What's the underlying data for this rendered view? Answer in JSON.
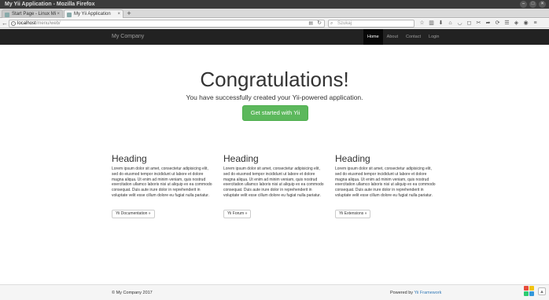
{
  "window": {
    "title": "My Yii Application - Mozilla Firefox"
  },
  "tabs": [
    {
      "label": "Start Page - Linux Mi",
      "active": false
    },
    {
      "label": "My Yii Application",
      "active": true
    }
  ],
  "address_bar": {
    "host": "localhost",
    "path": "/menu/web/",
    "search_placeholder": "Szukaj"
  },
  "site": {
    "brand": "My Company",
    "menu": [
      {
        "label": "Home",
        "active": true
      },
      {
        "label": "About",
        "active": false
      },
      {
        "label": "Contact",
        "active": false
      },
      {
        "label": "Login",
        "active": false
      }
    ]
  },
  "jumbotron": {
    "title": "Congratulations!",
    "lead": "You have successfully created your Yii-powered application.",
    "button": "Get started with Yii"
  },
  "columns": [
    {
      "heading": "Heading",
      "text": "Lorem ipsum dolor sit amet, consectetur adipisicing elit, sed do eiusmod tempor incididunt ut labore et dolore magna aliqua. Ut enim ad minim veniam, quis nostrud exercitation ullamco laboris nisi ut aliquip ex ea commodo consequat. Duis aute irure dolor in reprehenderit in voluptate velit esse cillum dolore eu fugiat nulla pariatur.",
      "button": "Yii Documentation »"
    },
    {
      "heading": "Heading",
      "text": "Lorem ipsum dolor sit amet, consectetur adipisicing elit, sed do eiusmod tempor incididunt ut labore et dolore magna aliqua. Ut enim ad minim veniam, quis nostrud exercitation ullamco laboris nisi ut aliquip ex ea commodo consequat. Duis aute irure dolor in reprehenderit in voluptate velit esse cillum dolore eu fugiat nulla pariatur.",
      "button": "Yii Forum »"
    },
    {
      "heading": "Heading",
      "text": "Lorem ipsum dolor sit amet, consectetur adipisicing elit, sed do eiusmod tempor incididunt ut labore et dolore magna aliqua. Ut enim ad minim veniam, quis nostrud exercitation ullamco laboris nisi ut aliquip ex ea commodo consequat. Duis aute irure dolor in reprehenderit in voluptate velit esse cillum dolore eu fugiat nulla pariatur.",
      "button": "Yii Extensions »"
    }
  ],
  "footer": {
    "copyright": "© My Company 2017",
    "powered_prefix": "Powered by ",
    "powered_link": "Yii Framework"
  },
  "colors": {
    "navbar_bg": "#222222",
    "cta_green": "#5cb85c",
    "link_blue": "#337ab7"
  }
}
